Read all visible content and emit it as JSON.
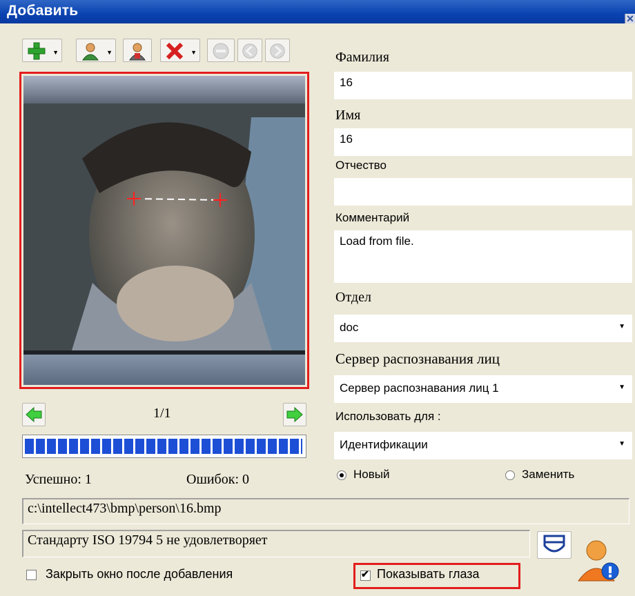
{
  "window": {
    "title": "Добавить",
    "close_glyph": "✕"
  },
  "toolbar": {
    "icons": [
      "add-icon",
      "user-dropdown-icon",
      "user-icon",
      "delete-icon",
      "minus-icon",
      "back-icon",
      "forward-icon"
    ]
  },
  "photo": {
    "description_icon": "face-photo",
    "counter": "1/1",
    "progress": 1.0
  },
  "stats": {
    "success": "Успешно: 1",
    "errors": "Ошибок: 0"
  },
  "path": "c:\\intellect473\\bmp\\person\\16.bmp",
  "iso_status": "Стандарту ISO 19794 5 не удовлетворяет",
  "form": {
    "last_name_label": "Фамилия",
    "last_name_value": "16",
    "first_name_label": "Имя",
    "first_name_value": "16",
    "patronymic_label": "Отчество",
    "patronymic_value": "",
    "comment_label": "Комментарий",
    "comment_value": "Load from file.",
    "department_label": "Отдел",
    "department_value": "doc",
    "server_label": "Сервер распознавания лиц",
    "server_value": "Сервер распознавания лиц 1",
    "use_for_label": "Использовать для :",
    "use_for_value": "Идентификации",
    "radio_new": "Новый",
    "radio_replace": "Заменить",
    "radio_selected": "Новый"
  },
  "options": {
    "close_after_add": "Закрыть окно после добавления",
    "close_after_add_checked": false,
    "show_eyes": "Показывать глаза",
    "show_eyes_checked": true
  },
  "colors": {
    "titlebar": "#0a43b1",
    "highlight": "#e31d1d",
    "progress": "#1d4fd6",
    "window_bg": "#ece9d8"
  }
}
